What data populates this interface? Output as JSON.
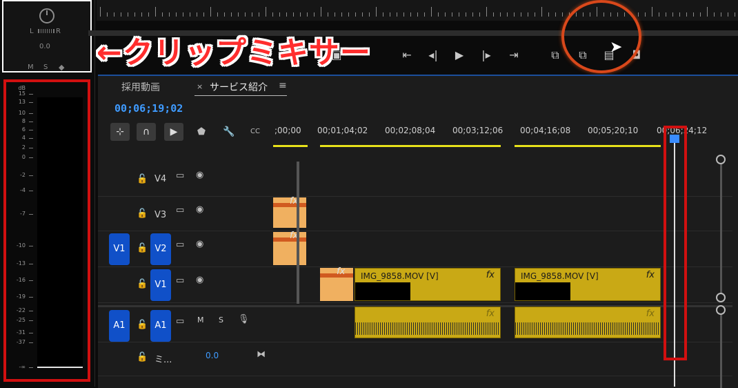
{
  "mixer": {
    "pan_left": "L",
    "pan_right": "R",
    "value": "0.0",
    "buttons": [
      "M",
      "S"
    ],
    "db_unit": "dB",
    "db_scale": [
      "15",
      "13",
      "10",
      "8",
      "6",
      "4",
      "2",
      "0",
      "-2",
      "-4",
      "-7",
      "-10",
      "-13",
      "-16",
      "-19",
      "-22",
      "-25",
      "-31",
      "-37",
      "-∞"
    ]
  },
  "banner": {
    "text": "←クリップミキサー"
  },
  "transport": {
    "icons": [
      "go-to-in-icon",
      "step-back-icon",
      "play-icon",
      "step-forward-icon",
      "go-to-out-icon",
      "lift-icon",
      "extract-icon",
      "export-frame-icon",
      "settings-icon"
    ]
  },
  "timeline": {
    "tabs": [
      {
        "label": "採用動画",
        "close": ""
      },
      {
        "label": "サービス紹介",
        "close": "×",
        "menu": "≡"
      }
    ],
    "timecode": "00;06;19;02",
    "ruler_labels": [
      ";00;00",
      "00;01;04;02",
      "00;02;08;04",
      "00;03;12;06",
      "00;04;16;08",
      "00;05;20;10",
      "00;06;24;12"
    ],
    "tracks": [
      {
        "name": "V4",
        "source": ""
      },
      {
        "name": "V3",
        "source": ""
      },
      {
        "name": "V2",
        "source": "V1"
      },
      {
        "name": "V1",
        "source": ""
      },
      {
        "name": "A1",
        "source": "A1",
        "audio": true,
        "m": "M",
        "s": "S"
      },
      {
        "name": "ミ...",
        "value": "0.0"
      }
    ],
    "clips": [
      {
        "name": "IMG_9858.MOV [V]",
        "fx": "fx"
      },
      {
        "name": "IMG_9858.MOV [V]",
        "fx": "fx"
      }
    ],
    "fx_label": "fx"
  },
  "colors": {
    "accent": "#1050c8",
    "timecode": "#3f9bff",
    "clip": "#c9a915",
    "highlight": "#d11010"
  }
}
